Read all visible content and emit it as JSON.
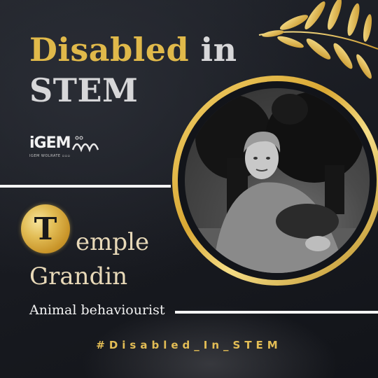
{
  "title": {
    "line1_gold": "Disabled",
    "line1_silver": "in",
    "line2": "STEM"
  },
  "logo": {
    "text": "iGEM",
    "subtext": "IGEM WOLRATE ▫▫▫"
  },
  "person": {
    "initial": "T",
    "name_rest": "emple",
    "surname": "Grandin",
    "role": "Animal behaviourist"
  },
  "hashtag": "#Disabled_In_STEM",
  "colors": {
    "gold": "#e0b94a",
    "background": "#181a20",
    "text_light": "#e8d9b8"
  }
}
